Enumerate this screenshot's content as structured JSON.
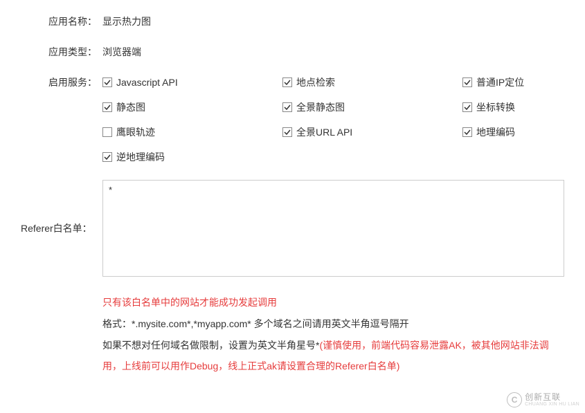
{
  "labels": {
    "appName": "应用名称：",
    "appType": "应用类型：",
    "services": "启用服务：",
    "referer": "Referer白名单："
  },
  "values": {
    "appName": "显示热力图",
    "appType": "浏览器端",
    "refererContent": "*"
  },
  "services": {
    "items": [
      {
        "label": "Javascript API",
        "checked": true
      },
      {
        "label": "地点检索",
        "checked": true
      },
      {
        "label": "普通IP定位",
        "checked": true
      },
      {
        "label": "静态图",
        "checked": true
      },
      {
        "label": "全景静态图",
        "checked": true
      },
      {
        "label": "坐标转换",
        "checked": true
      },
      {
        "label": "鹰眼轨迹",
        "checked": false
      },
      {
        "label": "全景URL API",
        "checked": true
      },
      {
        "label": "地理编码",
        "checked": true
      },
      {
        "label": "逆地理编码",
        "checked": true
      }
    ]
  },
  "hints": {
    "line1_red": "只有该白名单中的网站才能成功发起调用",
    "line2_black": "格式：*.mysite.com*,*myapp.com* 多个域名之间请用英文半角逗号隔开",
    "line3_prefix": "如果不想对任何域名做限制，设置为英文半角星号*",
    "line3_red": "(谨慎使用，前端代码容易泄露AK，被其他网站非法调用，上线前可以用作Debug，线上正式ak请设置合理的Referer白名单)"
  },
  "watermark": {
    "logo": "C",
    "cn": "创新互联",
    "en": "CHUANG XIN HU LIAN"
  }
}
